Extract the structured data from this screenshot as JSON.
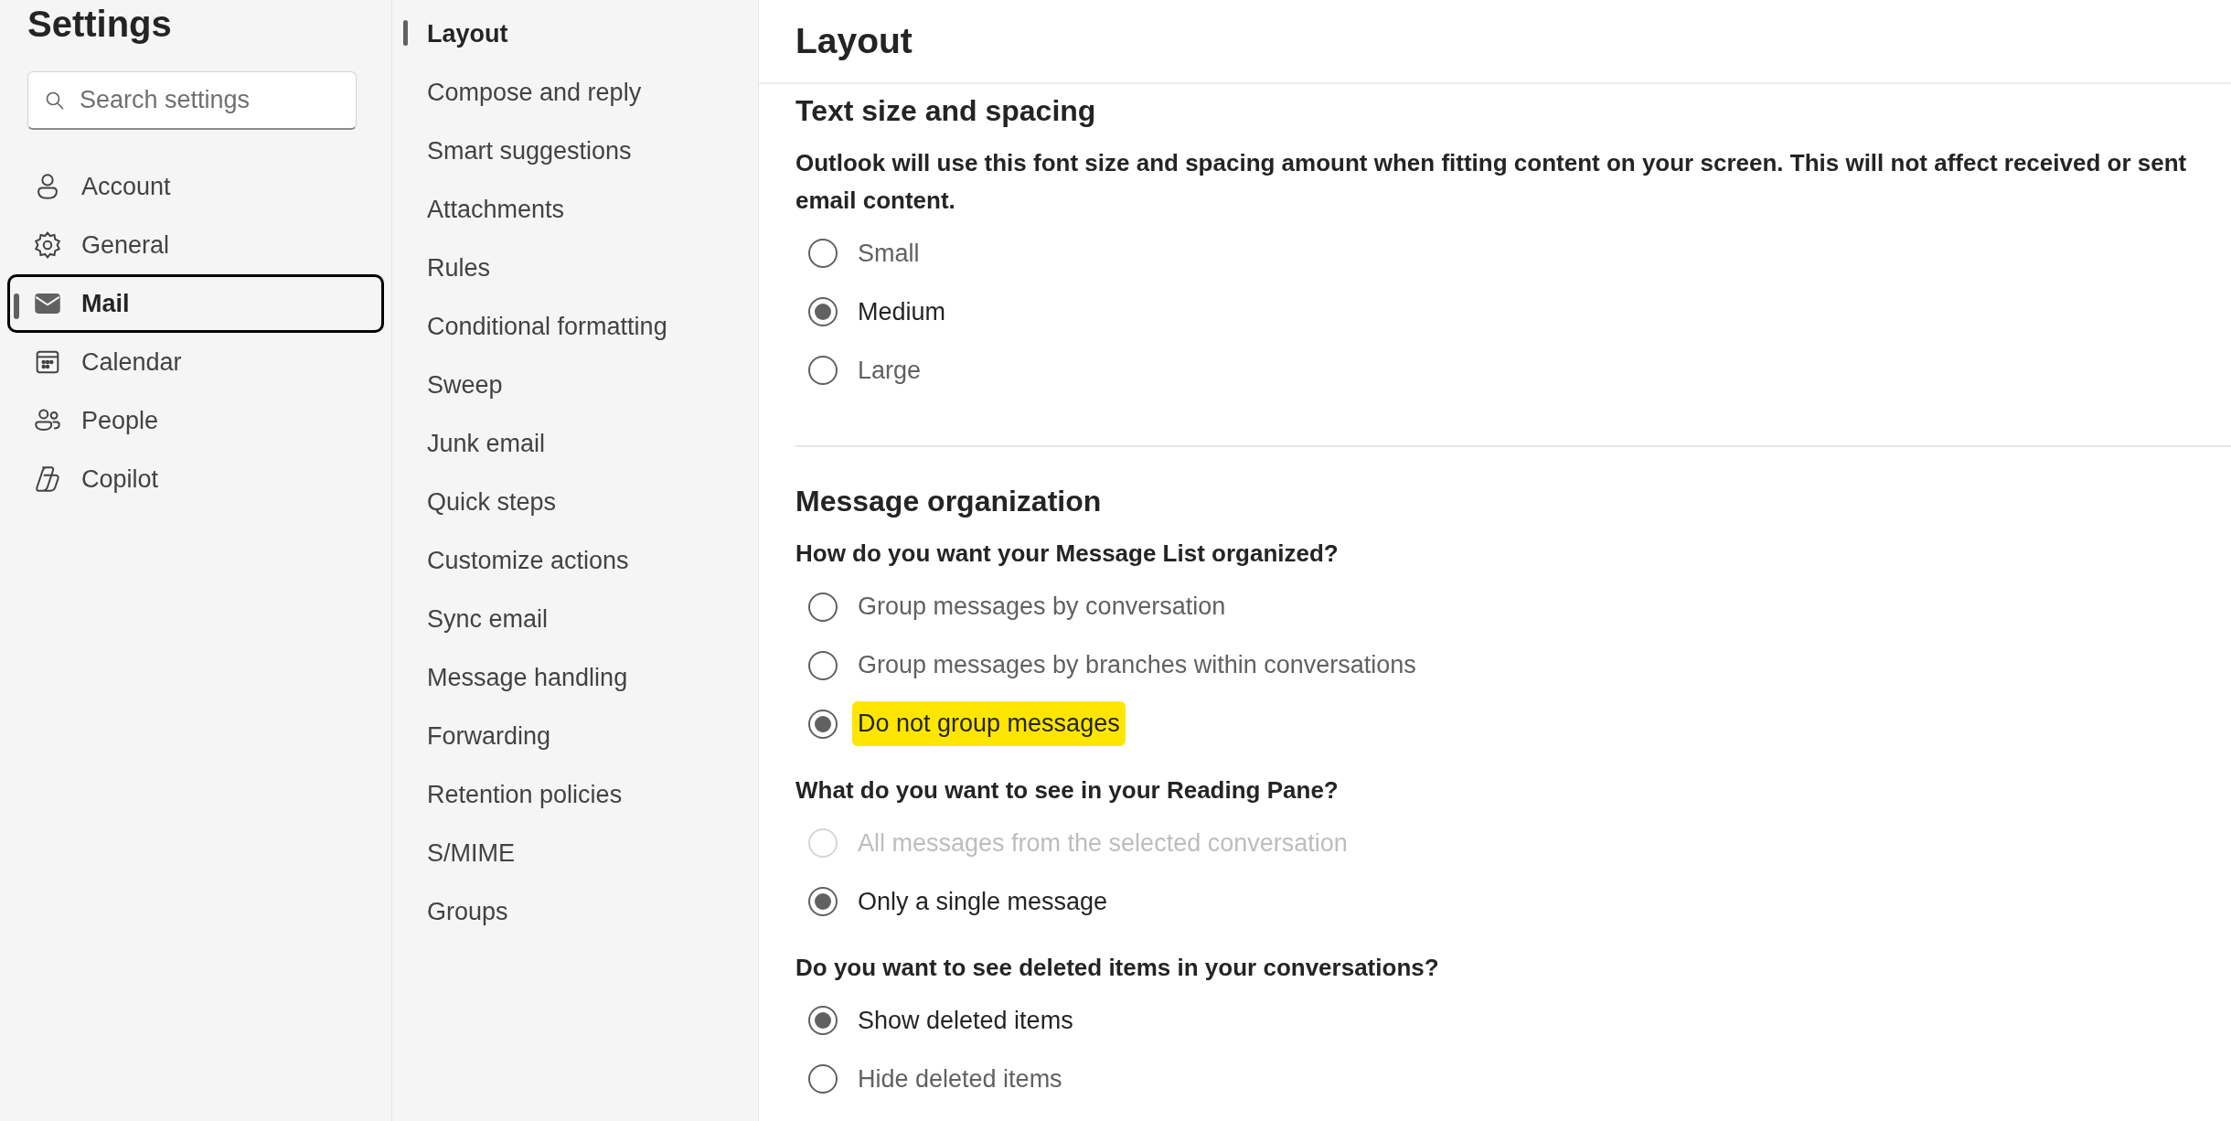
{
  "sidebar": {
    "title": "Settings",
    "search": {
      "placeholder": "Search settings"
    },
    "items": [
      {
        "label": "Account",
        "selected": false
      },
      {
        "label": "General",
        "selected": false
      },
      {
        "label": "Mail",
        "selected": true
      },
      {
        "label": "Calendar",
        "selected": false
      },
      {
        "label": "People",
        "selected": false
      },
      {
        "label": "Copilot",
        "selected": false
      }
    ]
  },
  "subnav": {
    "items": [
      {
        "label": "Layout",
        "selected": true
      },
      {
        "label": "Compose and reply",
        "selected": false
      },
      {
        "label": "Smart suggestions",
        "selected": false
      },
      {
        "label": "Attachments",
        "selected": false
      },
      {
        "label": "Rules",
        "selected": false
      },
      {
        "label": "Conditional formatting",
        "selected": false
      },
      {
        "label": "Sweep",
        "selected": false
      },
      {
        "label": "Junk email",
        "selected": false
      },
      {
        "label": "Quick steps",
        "selected": false
      },
      {
        "label": "Customize actions",
        "selected": false
      },
      {
        "label": "Sync email",
        "selected": false
      },
      {
        "label": "Message handling",
        "selected": false
      },
      {
        "label": "Forwarding",
        "selected": false
      },
      {
        "label": "Retention policies",
        "selected": false
      },
      {
        "label": "S/MIME",
        "selected": false
      },
      {
        "label": "Groups",
        "selected": false
      }
    ]
  },
  "content": {
    "title": "Layout",
    "sections": [
      {
        "heading": "Text size and spacing",
        "groups": [
          {
            "question": "Outlook will use this font size and spacing amount when fitting content on your screen. This will not affect received or sent email content.",
            "options": [
              {
                "label": "Small",
                "selected": false,
                "disabled": false,
                "highlighted": false
              },
              {
                "label": "Medium",
                "selected": true,
                "disabled": false,
                "highlighted": false
              },
              {
                "label": "Large",
                "selected": false,
                "disabled": false,
                "highlighted": false
              }
            ]
          }
        ]
      },
      {
        "heading": "Message organization",
        "groups": [
          {
            "question": "How do you want your Message List organized?",
            "options": [
              {
                "label": "Group messages by conversation",
                "selected": false,
                "disabled": false,
                "highlighted": false
              },
              {
                "label": "Group messages by branches within conversations",
                "selected": false,
                "disabled": false,
                "highlighted": false
              },
              {
                "label": "Do not group messages",
                "selected": true,
                "disabled": false,
                "highlighted": true
              }
            ]
          },
          {
            "question": "What do you want to see in your Reading Pane?",
            "options": [
              {
                "label": "All messages from the selected conversation",
                "selected": false,
                "disabled": true,
                "highlighted": false
              },
              {
                "label": "Only a single message",
                "selected": true,
                "disabled": false,
                "highlighted": false
              }
            ]
          },
          {
            "question": "Do you want to see deleted items in your conversations?",
            "options": [
              {
                "label": "Show deleted items",
                "selected": true,
                "disabled": false,
                "highlighted": false
              },
              {
                "label": "Hide deleted items",
                "selected": false,
                "disabled": false,
                "highlighted": false
              }
            ]
          }
        ]
      }
    ]
  }
}
